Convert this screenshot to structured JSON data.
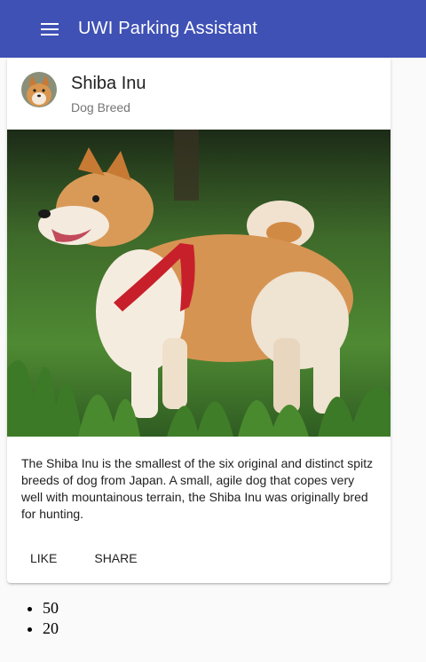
{
  "toolbar": {
    "title": "UWI Parking Assistant",
    "menu_icon": "menu-icon"
  },
  "card": {
    "title": "Shiba Inu",
    "subtitle": "Dog Breed",
    "avatar_icon": "shiba-avatar",
    "image": "shiba-inu-photo",
    "description": "The Shiba Inu is the smallest of the six original and distinct spitz breeds of dog from Japan. A small, agile dog that copes very well with mountainous terrain, the Shiba Inu was originally bred for hunting.",
    "actions": {
      "like": "LIKE",
      "share": "SHARE"
    }
  },
  "list": [
    "50",
    "20"
  ],
  "colors": {
    "primary": "#3f51b5",
    "background": "#fafafa"
  }
}
